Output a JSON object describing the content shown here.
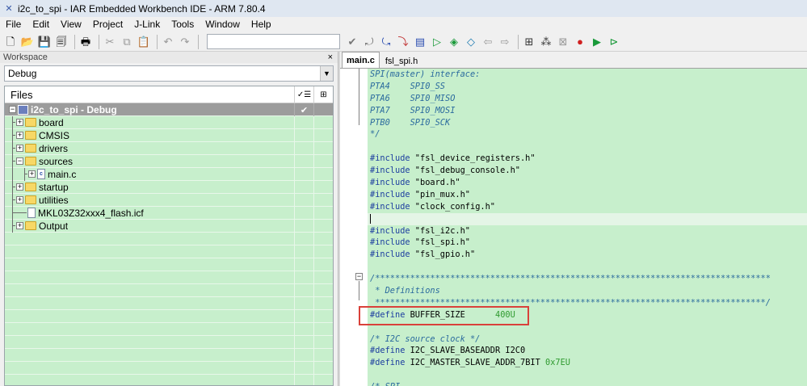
{
  "window": {
    "title": "i2c_to_spi - IAR Embedded Workbench IDE - ARM 7.80.4"
  },
  "menu": [
    "File",
    "Edit",
    "View",
    "Project",
    "J-Link",
    "Tools",
    "Window",
    "Help"
  ],
  "toolbar": {
    "combo_value": "",
    "icons": [
      "new-file-icon",
      "open-icon",
      "save-icon",
      "save-all-icon",
      "print-icon",
      "cut-icon",
      "copy-icon",
      "paste-icon",
      "undo-icon",
      "redo-icon",
      "find-icon",
      "find-prev-icon",
      "find-next-icon",
      "go-to-icon",
      "bookmark-icon",
      "toggle-bookmark-icon",
      "next-bookmark-icon",
      "prev-bookmark-icon",
      "navigate-back-icon",
      "navigate-forward-icon",
      "compile-icon",
      "make-icon",
      "stop-build-icon",
      "breakpoint-icon",
      "download-debug-icon",
      "debug-without-download-icon"
    ]
  },
  "workspace": {
    "title": "Workspace",
    "close": "×",
    "configuration": "Debug",
    "files_header": "Files",
    "root": {
      "label": "i2c_to_spi - Debug",
      "check": "✔"
    },
    "items": [
      {
        "label": "board",
        "type": "folder",
        "expander": "+",
        "level": 1
      },
      {
        "label": "CMSIS",
        "type": "folder",
        "expander": "+",
        "level": 1
      },
      {
        "label": "drivers",
        "type": "folder",
        "expander": "+",
        "level": 1
      },
      {
        "label": "sources",
        "type": "folder",
        "expander": "−",
        "level": 1
      },
      {
        "label": "main.c",
        "type": "file",
        "expander": "+",
        "level": 2
      },
      {
        "label": "startup",
        "type": "folder",
        "expander": "+",
        "level": 1
      },
      {
        "label": "utilities",
        "type": "folder",
        "expander": "+",
        "level": 1
      },
      {
        "label": "MKL03Z32xxx4_flash.icf",
        "type": "doc",
        "expander": "",
        "level": 1
      },
      {
        "label": "Output",
        "type": "folder",
        "expander": "+",
        "level": 1
      }
    ]
  },
  "editor": {
    "tabs": [
      {
        "label": "main.c",
        "active": true
      },
      {
        "label": "fsl_spi.h",
        "active": false
      }
    ],
    "lines": [
      [
        {
          "t": "SPI(master) interface:",
          "c": "c-comment"
        }
      ],
      [
        {
          "t": "PTA4    SPI0_SS",
          "c": "c-comment"
        }
      ],
      [
        {
          "t": "PTA6    SPI0_MISO",
          "c": "c-comment"
        }
      ],
      [
        {
          "t": "PTA7    SPI0_MOSI",
          "c": "c-comment"
        }
      ],
      [
        {
          "t": "PTB0    SPI0_SCK",
          "c": "c-comment"
        }
      ],
      [
        {
          "t": "*/",
          "c": "c-comment"
        }
      ],
      [],
      [
        {
          "t": "#include ",
          "c": "c-keyword"
        },
        {
          "t": "\"fsl_device_registers.h\"",
          "c": "c-text"
        }
      ],
      [
        {
          "t": "#include ",
          "c": "c-keyword"
        },
        {
          "t": "\"fsl_debug_console.h\"",
          "c": "c-text"
        }
      ],
      [
        {
          "t": "#include ",
          "c": "c-keyword"
        },
        {
          "t": "\"board.h\"",
          "c": "c-text"
        }
      ],
      [
        {
          "t": "#include ",
          "c": "c-keyword"
        },
        {
          "t": "\"pin_mux.h\"",
          "c": "c-text"
        }
      ],
      [
        {
          "t": "#include ",
          "c": "c-keyword"
        },
        {
          "t": "\"clock_config.h\"",
          "c": "c-text"
        }
      ],
      [],
      [
        {
          "t": "#include ",
          "c": "c-keyword"
        },
        {
          "t": "\"fsl_i2c.h\"",
          "c": "c-text"
        }
      ],
      [
        {
          "t": "#include ",
          "c": "c-keyword"
        },
        {
          "t": "\"fsl_spi.h\"",
          "c": "c-text"
        }
      ],
      [
        {
          "t": "#include ",
          "c": "c-keyword"
        },
        {
          "t": "\"fsl_gpio.h\"",
          "c": "c-text"
        }
      ],
      [],
      [
        {
          "t": "/*******************************************************************************",
          "c": "c-comment"
        }
      ],
      [
        {
          "t": " * Definitions",
          "c": "c-comment"
        }
      ],
      [
        {
          "t": " ******************************************************************************/",
          "c": "c-comment"
        }
      ],
      [
        {
          "t": "#define ",
          "c": "c-keyword"
        },
        {
          "t": "BUFFER_SIZE      ",
          "c": "c-text"
        },
        {
          "t": "400U",
          "c": "c-num"
        }
      ],
      [],
      [
        {
          "t": "/* I2C source clock */",
          "c": "c-comment"
        }
      ],
      [
        {
          "t": "#define ",
          "c": "c-keyword"
        },
        {
          "t": "I2C_SLAVE_BASEADDR I2C0",
          "c": "c-text"
        }
      ],
      [
        {
          "t": "#define ",
          "c": "c-keyword"
        },
        {
          "t": "I2C_MASTER_SLAVE_ADDR_7BIT ",
          "c": "c-text"
        },
        {
          "t": "0x7EU",
          "c": "c-num"
        }
      ],
      [],
      [
        {
          "t": "/* SPI ",
          "c": "c-comment"
        }
      ]
    ]
  }
}
